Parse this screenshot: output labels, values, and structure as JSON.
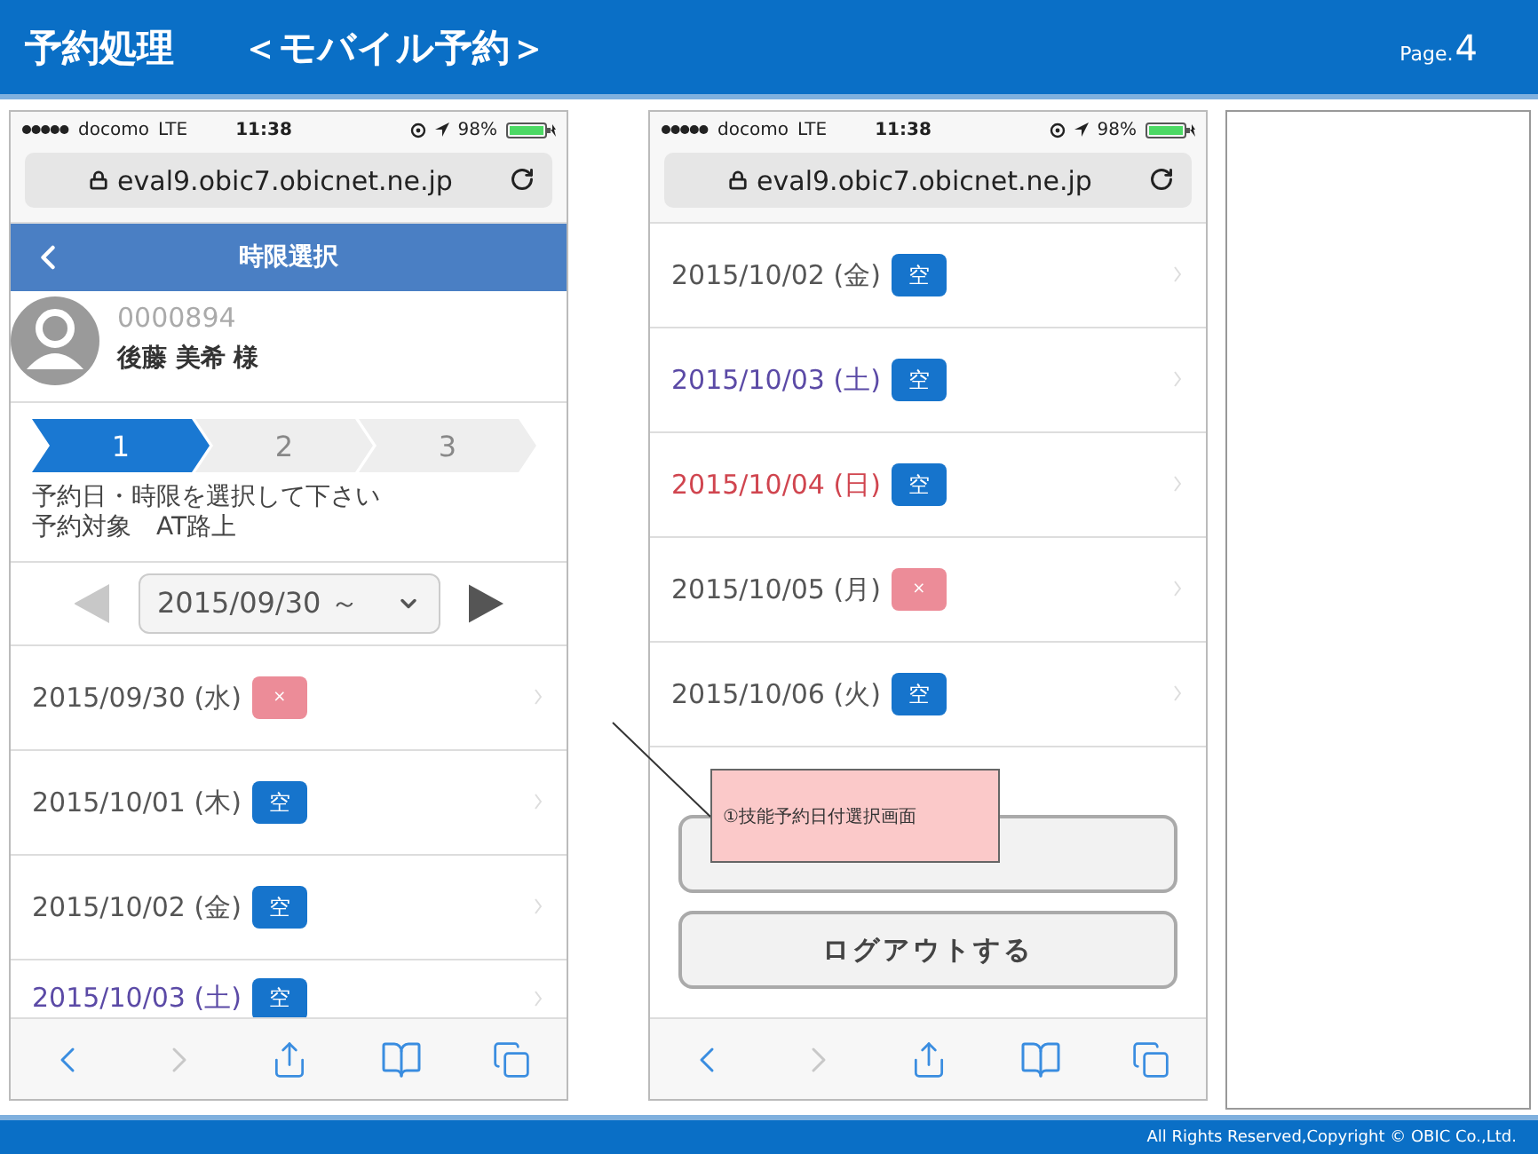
{
  "header": {
    "title": "予約処理",
    "subtitle": "＜モバイル予約＞",
    "page_label": "Page.",
    "page_number": "4"
  },
  "phones": [
    {
      "status_bar": {
        "carrier": "docomo",
        "network": "LTE",
        "time": "11:38",
        "battery": "98%"
      },
      "url": "eval9.obic7.obicnet.ne.jp",
      "nav_title": "時限選択",
      "profile": {
        "id": "0000894",
        "name": "後藤 美希 様"
      },
      "steps": [
        {
          "label": "1",
          "selected": true
        },
        {
          "label": "2",
          "selected": false
        },
        {
          "label": "3",
          "selected": false
        }
      ],
      "instructions": [
        "予約日・時限を選択して下さい",
        "予約対象　AT路上"
      ],
      "date_select": {
        "value": "2015/09/30 ～",
        "prev_disabled": true,
        "next_disabled": false
      },
      "rows": [
        {
          "date": "2015/09/30 (水)",
          "color": "#555555",
          "kind": "full",
          "badge": "×"
        },
        {
          "date": "2015/10/01 (木)",
          "color": "#555555",
          "kind": "available",
          "badge": "空"
        },
        {
          "date": "2015/10/02 (金)",
          "color": "#555555",
          "kind": "available",
          "badge": "空"
        },
        {
          "date": "2015/10/03 (土)",
          "color": "#5b4aa6",
          "kind": "available",
          "badge": "空"
        }
      ]
    },
    {
      "status_bar": {
        "carrier": "docomo",
        "network": "LTE",
        "time": "11:38",
        "battery": "98%"
      },
      "url": "eval9.obic7.obicnet.ne.jp",
      "rows": [
        {
          "date": "2015/10/02 (金)",
          "color": "#555555",
          "kind": "available",
          "badge": "空"
        },
        {
          "date": "2015/10/03 (土)",
          "color": "#5b4aa6",
          "kind": "available",
          "badge": "空"
        },
        {
          "date": "2015/10/04 (日)",
          "color": "#d0454f",
          "kind": "available",
          "badge": "空"
        },
        {
          "date": "2015/10/05 (月)",
          "color": "#555555",
          "kind": "full",
          "badge": "×"
        },
        {
          "date": "2015/10/06 (火)",
          "color": "#555555",
          "kind": "available",
          "badge": "空"
        }
      ],
      "buttons": [
        {
          "kind": "blank"
        },
        {
          "kind": "text",
          "label": "ログアウトする"
        }
      ]
    }
  ],
  "callout": {
    "text": "①技能予約日付選択画面"
  },
  "footer": {
    "copyright": "All Rights Reserved,Copyright ©  OBIC Co.,Ltd."
  }
}
